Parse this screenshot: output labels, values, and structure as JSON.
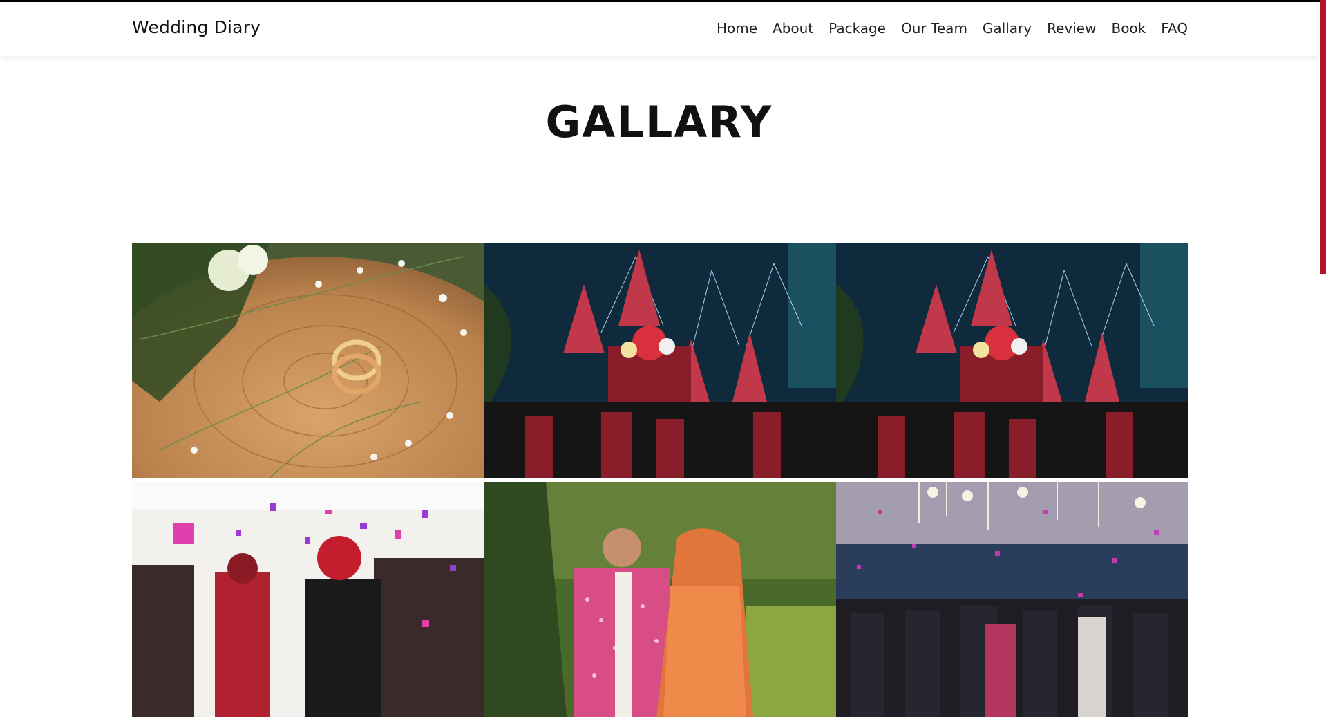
{
  "brand": "Wedding Diary",
  "nav": [
    {
      "label": "Home"
    },
    {
      "label": "About"
    },
    {
      "label": "Package"
    },
    {
      "label": "Our Team"
    },
    {
      "label": "Gallary"
    },
    {
      "label": "Review"
    },
    {
      "label": "Book"
    },
    {
      "label": "FAQ"
    }
  ],
  "section_title": "GALLARY",
  "accent_color": "#b5122e",
  "gallery": [
    {
      "icon": "ring-photo"
    },
    {
      "icon": "fireworks-photo"
    },
    {
      "icon": "fireworks-photo"
    },
    {
      "icon": "confetti-ceremony-photo"
    },
    {
      "icon": "couple-portrait-photo"
    },
    {
      "icon": "crowd-celebration-photo"
    }
  ]
}
